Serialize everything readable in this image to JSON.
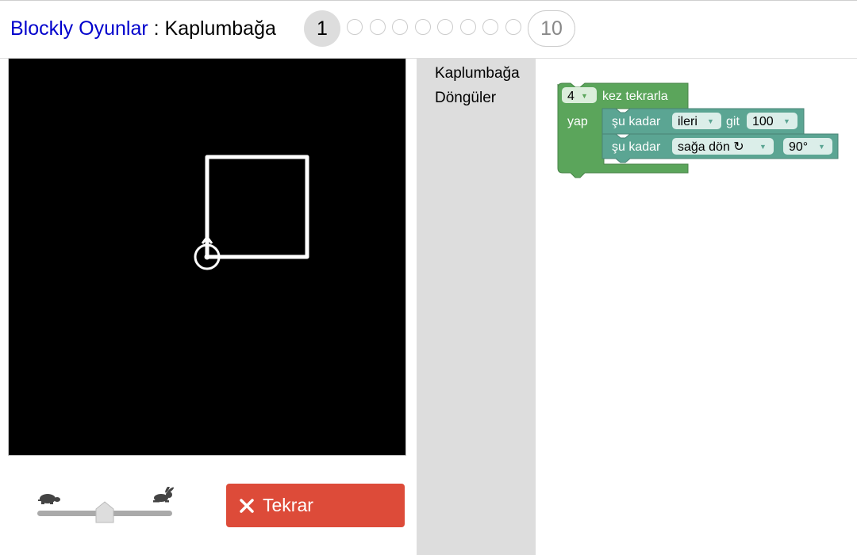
{
  "header": {
    "app_link": "Blockly Oyunlar",
    "separator": " : ",
    "game_name": "Kaplumbağa"
  },
  "levels": {
    "current": "1",
    "last": "10"
  },
  "toolbox": {
    "categories": [
      "Kaplumbağa",
      "Döngüler"
    ]
  },
  "controls": {
    "run_button_label": "Tekrar",
    "slow_icon": "turtle-icon",
    "fast_icon": "rabbit-icon",
    "speed_fraction": 0.5
  },
  "blocks": {
    "repeat": {
      "count": "4",
      "label": "kez tekrarla",
      "do_label": "yap"
    },
    "move": {
      "prefix": "şu kadar",
      "direction": "ileri",
      "verb": "git",
      "amount": "100"
    },
    "turn": {
      "prefix": "şu kadar",
      "direction": "sağa dön ↻",
      "angle": "90°"
    }
  },
  "colors": {
    "loop_block": "#5ba55b",
    "turtle_block": "#5ba593",
    "run_button": "#dd4b39",
    "link": "#0000cc"
  }
}
